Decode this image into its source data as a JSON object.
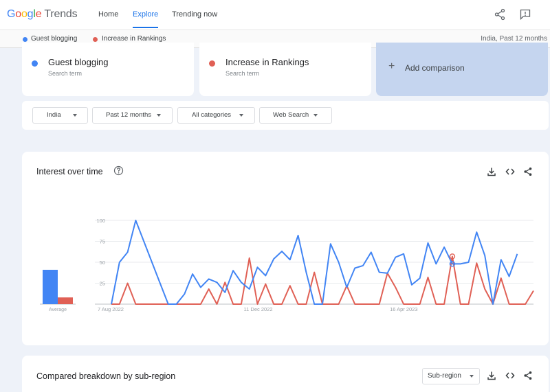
{
  "header": {
    "logo_google": [
      "G",
      "o",
      "o",
      "g",
      "l",
      "e"
    ],
    "logo_trends": "Trends",
    "nav": [
      "Home",
      "Explore",
      "Trending now"
    ],
    "active_nav": "Explore"
  },
  "subbar": {
    "terms": [
      "Guest blogging",
      "Increase in Rankings"
    ],
    "context": "India, Past 12 months"
  },
  "terms": [
    {
      "name": "Guest blogging",
      "type": "Search term",
      "color": "#4285f4"
    },
    {
      "name": "Increase in Rankings",
      "type": "Search term",
      "color": "#e06055"
    }
  ],
  "add_comparison": {
    "plus": "+",
    "label": "Add comparison"
  },
  "filters": {
    "region": "India",
    "time": "Past 12 months",
    "category": "All categories",
    "search_type": "Web Search"
  },
  "interest_over_time": {
    "title": "Interest over time"
  },
  "breakdown": {
    "title": "Compared breakdown by sub-region",
    "select": "Sub-region"
  },
  "chart_data": {
    "type": "line",
    "title": "",
    "xlabel": "",
    "ylabel": "",
    "ylim": [
      0,
      100
    ],
    "yticks": [
      100,
      75,
      50,
      25
    ],
    "x_tick_labels": [
      "7 Aug 2022",
      "11 Dec 2022",
      "16 Apr 2023"
    ],
    "x_tick_indices": [
      0,
      18,
      36
    ],
    "grid": true,
    "series": [
      {
        "name": "Guest blogging",
        "color": "#4285f4",
        "values": [
          0,
          50,
          62,
          100,
          75,
          50,
          25,
          0,
          0,
          12,
          36,
          20,
          30,
          26,
          14,
          40,
          26,
          18,
          44,
          34,
          54,
          63,
          53,
          82,
          38,
          0,
          0,
          72,
          50,
          20,
          43,
          46,
          62,
          38,
          37,
          56,
          60,
          23,
          31,
          73,
          48,
          68,
          48,
          48,
          50,
          86,
          58,
          0,
          53,
          33,
          60
        ]
      },
      {
        "name": "Increase in Rankings",
        "color": "#e06055",
        "values": [
          0,
          0,
          25,
          0,
          0,
          0,
          0,
          0,
          0,
          0,
          0,
          0,
          18,
          0,
          26,
          0,
          0,
          55,
          0,
          24,
          0,
          0,
          22,
          0,
          0,
          38,
          0,
          0,
          0,
          22,
          0,
          0,
          0,
          0,
          37,
          20,
          0,
          0,
          0,
          32,
          0,
          0,
          57,
          0,
          0,
          49,
          18,
          0,
          31,
          0,
          0,
          0,
          16
        ]
      }
    ],
    "average": {
      "label": "Average",
      "values": [
        41,
        8
      ]
    }
  }
}
